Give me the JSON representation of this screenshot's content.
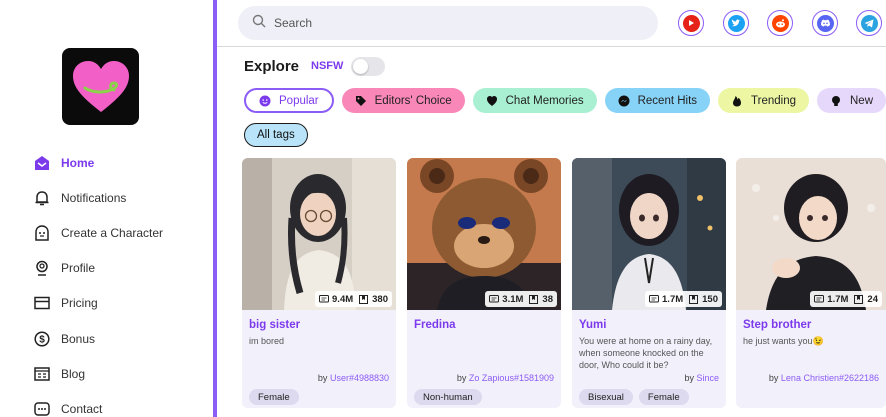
{
  "colors": {
    "accent": "#8b5cf6",
    "logo_heart": "#f25fc7",
    "logo_bg": "#0b0b0b"
  },
  "nav": [
    {
      "label": "Home",
      "icon": "home-icon",
      "active": true
    },
    {
      "label": "Notifications",
      "icon": "bell-icon",
      "active": false
    },
    {
      "label": "Create a Character",
      "icon": "character-icon",
      "active": false
    },
    {
      "label": "Profile",
      "icon": "profile-icon",
      "active": false
    },
    {
      "label": "Pricing",
      "icon": "card-icon",
      "active": false
    },
    {
      "label": "Bonus",
      "icon": "dollar-icon",
      "active": false
    },
    {
      "label": "Blog",
      "icon": "blog-icon",
      "active": false
    },
    {
      "label": "Contact",
      "icon": "chat-icon",
      "active": false
    }
  ],
  "search": {
    "placeholder": "Search"
  },
  "social": [
    "youtube-icon",
    "twitter-icon",
    "reddit-icon",
    "discord-icon",
    "telegram-icon"
  ],
  "explore": {
    "title": "Explore",
    "nsfw_label": "NSFW",
    "nsfw_on": false
  },
  "tags": [
    {
      "label": "Popular",
      "color": "#ffffff"
    },
    {
      "label": "Editors' Choice",
      "color": "#f987b8"
    },
    {
      "label": "Chat Memories",
      "color": "#a9f0d2"
    },
    {
      "label": "Recent Hits",
      "color": "#87d3f8"
    },
    {
      "label": "Trending",
      "color": "#ecf6a3"
    },
    {
      "label": "New",
      "color": "#e6d8fb"
    }
  ],
  "all_tags_label": "All tags",
  "cards": [
    {
      "name": "big sister",
      "desc": "im bored",
      "chats": "9.4M",
      "saves": "380",
      "by": "by",
      "user": "User#4988830",
      "tags": [
        "Female"
      ]
    },
    {
      "name": "Fredina",
      "desc": "",
      "chats": "3.1M",
      "saves": "38",
      "by": "by",
      "user": "Zo Zapious#1581909",
      "tags": [
        "Non-human"
      ]
    },
    {
      "name": "Yumi",
      "desc": "You were at home on a rainy day, when someone knocked on the door, Who could it be?",
      "chats": "1.7M",
      "saves": "150",
      "by": "by",
      "user": "Since",
      "tags": [
        "Bisexual",
        "Female"
      ]
    },
    {
      "name": "Step brother",
      "desc": "he just wants you😉",
      "chats": "1.7M",
      "saves": "24",
      "by": "by",
      "user": "Lena Christien#2622186",
      "tags": []
    }
  ]
}
